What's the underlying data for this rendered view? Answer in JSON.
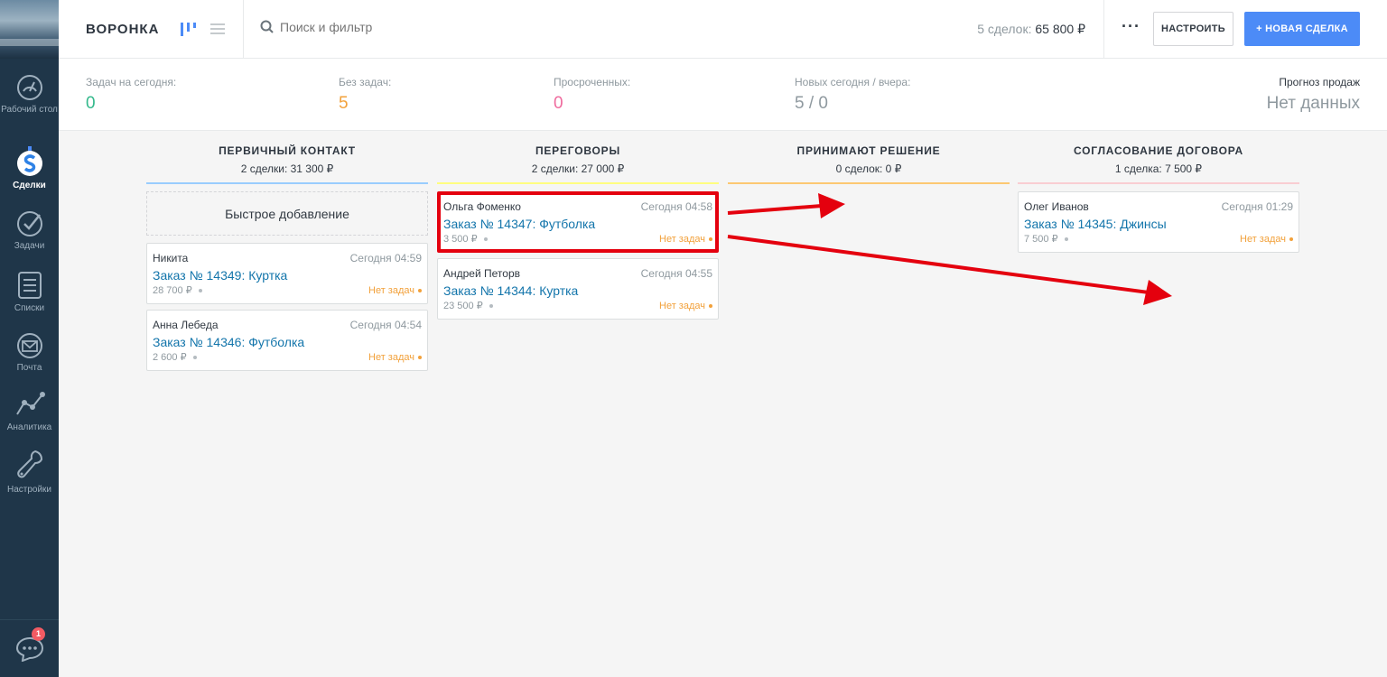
{
  "sidebar": {
    "items": [
      {
        "label": "Рабочий стол",
        "icon": "dashboard-icon"
      },
      {
        "label": "Сделки",
        "icon": "deals-icon",
        "active": true
      },
      {
        "label": "Задачи",
        "icon": "tasks-icon"
      },
      {
        "label": "Списки",
        "icon": "lists-icon"
      },
      {
        "label": "Почта",
        "icon": "mail-icon"
      },
      {
        "label": "Аналитика",
        "icon": "analytics-icon"
      },
      {
        "label": "Настройки",
        "icon": "settings-icon"
      }
    ],
    "chat_badge": "1"
  },
  "topbar": {
    "title": "ВОРОНКА",
    "search_placeholder": "Поиск и фильтр",
    "summary_label": "5 сделок:",
    "summary_value": "65 800 ₽",
    "more_label": "···",
    "settings_button": "НАСТРОИТЬ",
    "new_deal_button": "+ НОВАЯ СДЕЛКА"
  },
  "stats": {
    "today_tasks": {
      "label": "Задач на сегодня:",
      "value": "0",
      "color": "#34b98c"
    },
    "no_tasks": {
      "label": "Без задач:",
      "value": "5",
      "color": "#f2a13b"
    },
    "overdue": {
      "label": "Просроченных:",
      "value": "0",
      "color": "#ef6b9e"
    },
    "new_today": {
      "label": "Новых сегодня / вчера:",
      "value": "5 / 0",
      "color": "#8f999f"
    },
    "forecast": {
      "label": "Прогноз продаж",
      "value": "Нет данных"
    }
  },
  "columns": [
    {
      "title": "ПЕРВИЧНЫЙ КОНТАКТ",
      "subtitle": "2 сделки: 31 300 ₽",
      "color": "#99ccfd",
      "quick_add": "Быстрое добавление",
      "cards": [
        {
          "contact": "Никита",
          "date": "Сегодня 04:59",
          "name": "Заказ № 14349: Куртка",
          "price": "28 700 ₽",
          "tasks": "Нет задач"
        },
        {
          "contact": "Анна Лебеда",
          "date": "Сегодня 04:54",
          "name": "Заказ № 14346: Футболка",
          "price": "2 600 ₽",
          "tasks": "Нет задач"
        }
      ]
    },
    {
      "title": "ПЕРЕГОВОРЫ",
      "subtitle": "2 сделки: 27 000 ₽",
      "color": "#fffd7f",
      "cards": [
        {
          "contact": "Ольга Фоменко",
          "date": "Сегодня 04:58",
          "name": "Заказ № 14347: Футболка",
          "price": "3 500 ₽",
          "tasks": "Нет задач",
          "highlighted": true
        },
        {
          "contact": "Андрей Петорв",
          "date": "Сегодня 04:55",
          "name": "Заказ № 14344: Куртка",
          "price": "23 500 ₽",
          "tasks": "Нет задач"
        }
      ]
    },
    {
      "title": "ПРИНИМАЮТ РЕШЕНИЕ",
      "subtitle": "0 сделок: 0 ₽",
      "color": "#fcc872",
      "cards": []
    },
    {
      "title": "СОГЛАСОВАНИЕ ДОГОВОРА",
      "subtitle": "1 сделка: 7 500 ₽",
      "color": "#f9cdd2",
      "cards": [
        {
          "contact": "Олег Иванов",
          "date": "Сегодня 01:29",
          "name": "Заказ № 14345: Джинсы",
          "price": "7 500 ₽",
          "tasks": "Нет задач"
        }
      ]
    }
  ],
  "annotation_color": "#e4000e"
}
